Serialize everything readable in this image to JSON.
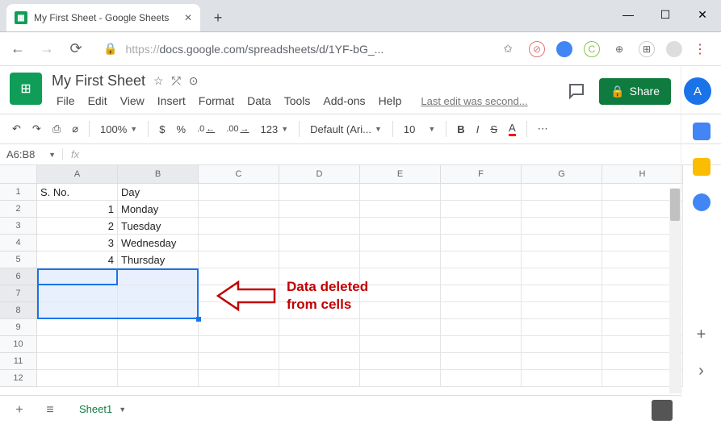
{
  "browser": {
    "tab_title": "My First Sheet - Google Sheets",
    "favicon_text": "▦",
    "url_prefix": "https://",
    "url": "docs.google.com/spreadsheets/d/1YF-bG_...",
    "nav": {
      "back": "←",
      "forward": "→",
      "reload": "⟳"
    },
    "new_tab": "+",
    "window": {
      "min": "—",
      "max": "☐",
      "close": "✕"
    }
  },
  "header": {
    "doc_title": "My First Sheet",
    "star": "☆",
    "move": "⤱",
    "cloud": "⊙",
    "menu": [
      "File",
      "Edit",
      "View",
      "Insert",
      "Format",
      "Data",
      "Tools",
      "Add-ons",
      "Help"
    ],
    "last_edit": "Last edit was second...",
    "share": "Share",
    "avatar": "A"
  },
  "toolbar": {
    "undo": "↶",
    "redo": "↷",
    "print": "⎙",
    "paint": "⌀",
    "zoom": "100%",
    "currency": "$",
    "percent": "%",
    "dec_less": ".0←",
    "dec_more": ".00→",
    "more_fmt": "123",
    "font": "Default (Ari...",
    "size": "10",
    "bold": "B",
    "italic": "I",
    "strike": "S",
    "text_color": "A",
    "more": "⋯"
  },
  "formula": {
    "name_box": "A6:B8",
    "fx": "fx"
  },
  "grid": {
    "cols": [
      "A",
      "B",
      "C",
      "D",
      "E",
      "F",
      "G",
      "H"
    ],
    "rows": [
      {
        "n": "1",
        "cells": [
          "S. No.",
          "Day",
          "",
          "",
          "",
          "",
          "",
          ""
        ]
      },
      {
        "n": "2",
        "cells": [
          "1",
          "Monday",
          "",
          "",
          "",
          "",
          "",
          ""
        ]
      },
      {
        "n": "3",
        "cells": [
          "2",
          "Tuesday",
          "",
          "",
          "",
          "",
          "",
          ""
        ]
      },
      {
        "n": "4",
        "cells": [
          "3",
          "Wednesday",
          "",
          "",
          "",
          "",
          "",
          ""
        ]
      },
      {
        "n": "5",
        "cells": [
          "4",
          "Thursday",
          "",
          "",
          "",
          "",
          "",
          ""
        ]
      },
      {
        "n": "6",
        "cells": [
          "",
          "",
          "",
          "",
          "",
          "",
          "",
          ""
        ]
      },
      {
        "n": "7",
        "cells": [
          "",
          "",
          "",
          "",
          "",
          "",
          "",
          ""
        ]
      },
      {
        "n": "8",
        "cells": [
          "",
          "",
          "",
          "",
          "",
          "",
          "",
          ""
        ]
      },
      {
        "n": "9",
        "cells": [
          "",
          "",
          "",
          "",
          "",
          "",
          "",
          ""
        ]
      },
      {
        "n": "10",
        "cells": [
          "",
          "",
          "",
          "",
          "",
          "",
          "",
          ""
        ]
      },
      {
        "n": "11",
        "cells": [
          "",
          "",
          "",
          "",
          "",
          "",
          "",
          ""
        ]
      },
      {
        "n": "12",
        "cells": [
          "",
          "",
          "",
          "",
          "",
          "",
          "",
          ""
        ]
      }
    ],
    "selected_cols": [
      "A",
      "B"
    ],
    "selected_rows": [
      "6",
      "7",
      "8"
    ]
  },
  "annotation": {
    "line1": "Data deleted",
    "line2": "from cells"
  },
  "sheet_tabs": {
    "add": "+",
    "menu": "≡",
    "tab1": "Sheet1"
  },
  "side_chevron": "›"
}
